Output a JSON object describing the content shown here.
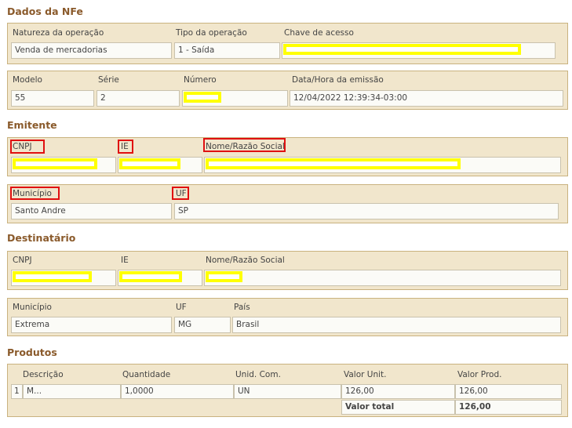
{
  "nfe": {
    "title": "Dados da NFe",
    "natureza_label": "Natureza da operação",
    "natureza_value": "Venda de mercadorias",
    "tipo_label": "Tipo da operação",
    "tipo_value": "1 - Saída",
    "chave_label": "Chave de acesso",
    "modelo_label": "Modelo",
    "modelo_value": "55",
    "serie_label": "Série",
    "serie_value": "2",
    "numero_label": "Número",
    "data_label": "Data/Hora da emissão",
    "data_value": "12/04/2022 12:39:34-03:00"
  },
  "emitente": {
    "title": "Emitente",
    "cnpj_label": "CNPJ",
    "ie_label": "IE",
    "nome_label": "Nome/Razão Social",
    "municipio_label": "Município",
    "municipio_value": "Santo Andre",
    "uf_label": "UF",
    "uf_value": "SP"
  },
  "destinatario": {
    "title": "Destinatário",
    "cnpj_label": "CNPJ",
    "ie_label": "IE",
    "nome_label": "Nome/Razão Social",
    "municipio_label": "Município",
    "municipio_value": "Extrema",
    "uf_label": "UF",
    "uf_value": "MG",
    "pais_label": "País",
    "pais_value": "Brasil"
  },
  "produtos": {
    "title": "Produtos",
    "headers": [
      "Descrição",
      "Quantidade",
      "Unid. Com.",
      "Valor Unit.",
      "Valor Prod."
    ],
    "rows": [
      {
        "index": "1",
        "descricao": "M...",
        "quantidade": "1,0000",
        "unidade": "UN",
        "valor_unit": "126,00",
        "valor_prod": "126,00"
      }
    ],
    "total_label": "Valor total",
    "total_value": "126,00"
  },
  "colors": {
    "section_title": "#8a5a2b",
    "panel_bg": "#f1e6cc",
    "redaction": "#ffff00",
    "highlight_box": "#e01010"
  }
}
